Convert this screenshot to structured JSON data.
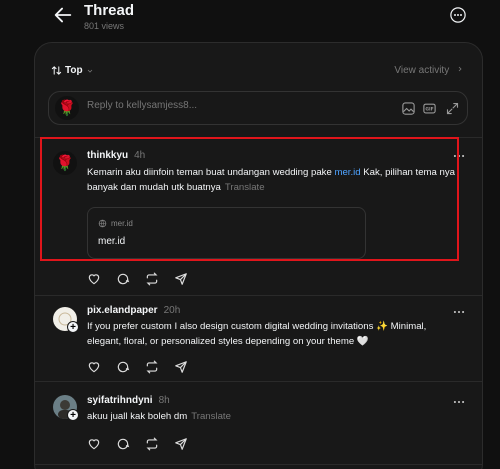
{
  "header": {
    "title": "Thread",
    "views": "801 views"
  },
  "sortbar": {
    "sort_label": "Top",
    "view_activity": "View activity"
  },
  "reply": {
    "placeholder": "Reply to kellysamjess8..."
  },
  "posts": [
    {
      "username": "thinkkyu",
      "time": "4h",
      "text_before": "Kemarin aku diinfoin teman buat undangan wedding pake ",
      "link_text": "mer.id",
      "text_after": " Kak, pilihan tema nya banyak dan mudah utk buatnya",
      "translate": "Translate",
      "card": {
        "domain": "mer.id",
        "title": "mer.id"
      }
    },
    {
      "username": "pix.elandpaper",
      "time": "20h",
      "text": "If you prefer custom I also design custom digital wedding invitations ✨ Minimal, elegant, floral, or personalized styles depending on your theme 🤍"
    },
    {
      "username": "syifatrihndyni",
      "time": "8h",
      "text": "akuu juall kak boleh dm",
      "translate": "Translate"
    }
  ],
  "colors": {
    "background": "#101010",
    "panel": "#181818",
    "link": "#4ea3ff",
    "highlight": "#e0151b"
  }
}
